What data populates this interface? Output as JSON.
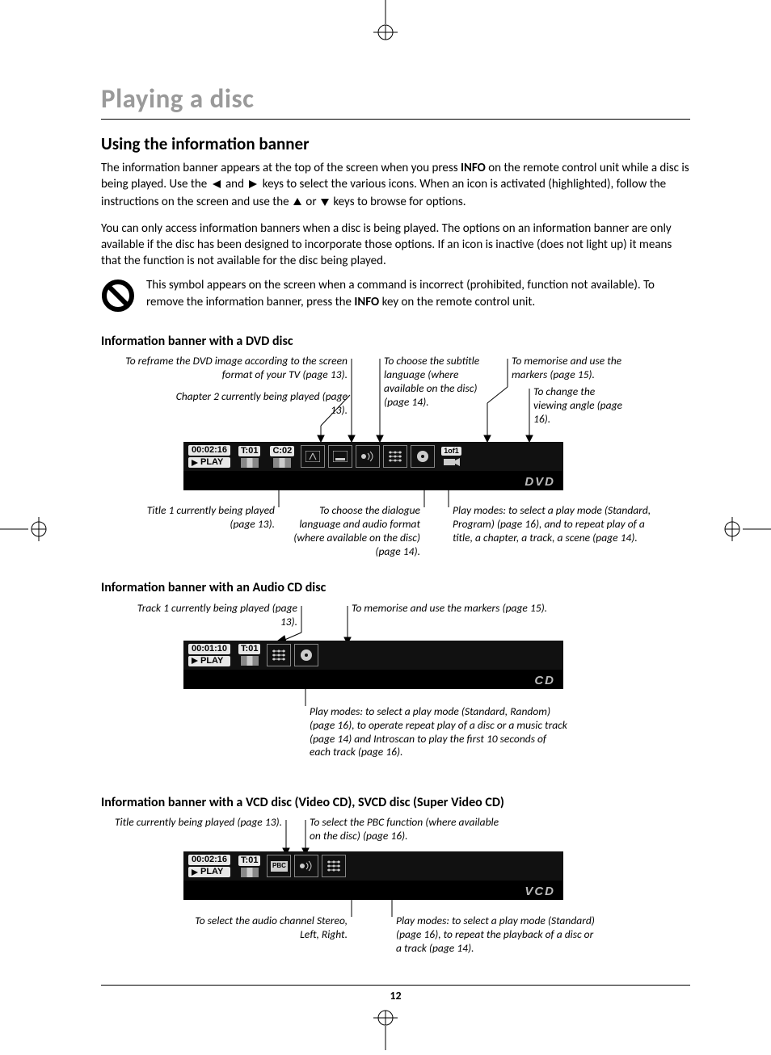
{
  "page_number": "12",
  "title": "Playing a disc",
  "section": "Using the information banner",
  "para1_a": "The information banner appears at the top of the screen when you press ",
  "para1_b": "INFO",
  "para1_c": " on the remote control unit while a disc is being played. Use the ",
  "para1_d": " and ",
  "para1_e": " keys to select the various icons. When an icon is activated (highlighted), follow the instructions on the screen and use the ",
  "para1_f": " or ",
  "para1_g": " keys to browse for options.",
  "para2": "You can only access information banners when a disc is being played. The options on an information banner are only available if the disc has been designed to incorporate those options. If an icon is inactive (does not light up) it means that the function is not available for the disc being played.",
  "note_a": "This symbol appears on the screen when a command is incorrect (prohibited, function not available). To remove the information banner, press the ",
  "note_b": "INFO",
  "note_c": " key on the remote control unit.",
  "dvd": {
    "heading": "Information banner with a DVD disc",
    "callout_reframe": "To reframe the DVD image according to the screen format of your TV (page 13).",
    "callout_chapter": "Chapter 2 currently being played (page 13).",
    "callout_subtitle": "To choose the subtitle language (where available on the disc) (page 14).",
    "callout_markers": "To memorise and use the markers (page 15).",
    "callout_angle": "To change the viewing angle (page 16).",
    "callout_title": "Title 1 currently being played (page 13).",
    "callout_dialogue": "To choose the dialogue language and audio format (where available on the disc) (page 14).",
    "callout_playmodes": "Play modes: to select a play mode (Standard, Program) (page 16), and to repeat play of a title, a chapter, a track, a scene (page 14).",
    "banner": {
      "time": "00:02:16",
      "status": "PLAY",
      "title_chip": "T:01",
      "chapter_chip": "C:02",
      "angle_label": "1of1",
      "brand": "DVD"
    }
  },
  "cd": {
    "heading": "Information banner with an Audio CD disc",
    "callout_track": "Track 1 currently being played (page 13).",
    "callout_markers": "To memorise and use the markers (page 15).",
    "callout_playmodes": "Play modes: to select a play mode (Standard, Random) (page 16), to operate repeat play of a disc or a music track (page 14) and Introscan to play the first 10 seconds of each track (page 16).",
    "banner": {
      "time": "00:01:10",
      "status": "PLAY",
      "title_chip": "T:01",
      "brand": "CD"
    }
  },
  "vcd": {
    "heading": "Information banner with a VCD disc (Video CD), SVCD disc (Super Video CD)",
    "callout_title": "Title currently being played (page 13).",
    "callout_pbc": "To select the PBC function (where available on the disc) (page 16).",
    "callout_audio": "To select the audio channel Stereo, Left, Right.",
    "callout_playmodes": "Play modes: to select a play mode (Standard) (page 16), to repeat the playback of a disc or a track (page 14).",
    "banner": {
      "time": "00:02:16",
      "status": "PLAY",
      "title_chip": "T:01",
      "pbc_label": "PBC",
      "brand": "VCD"
    }
  }
}
